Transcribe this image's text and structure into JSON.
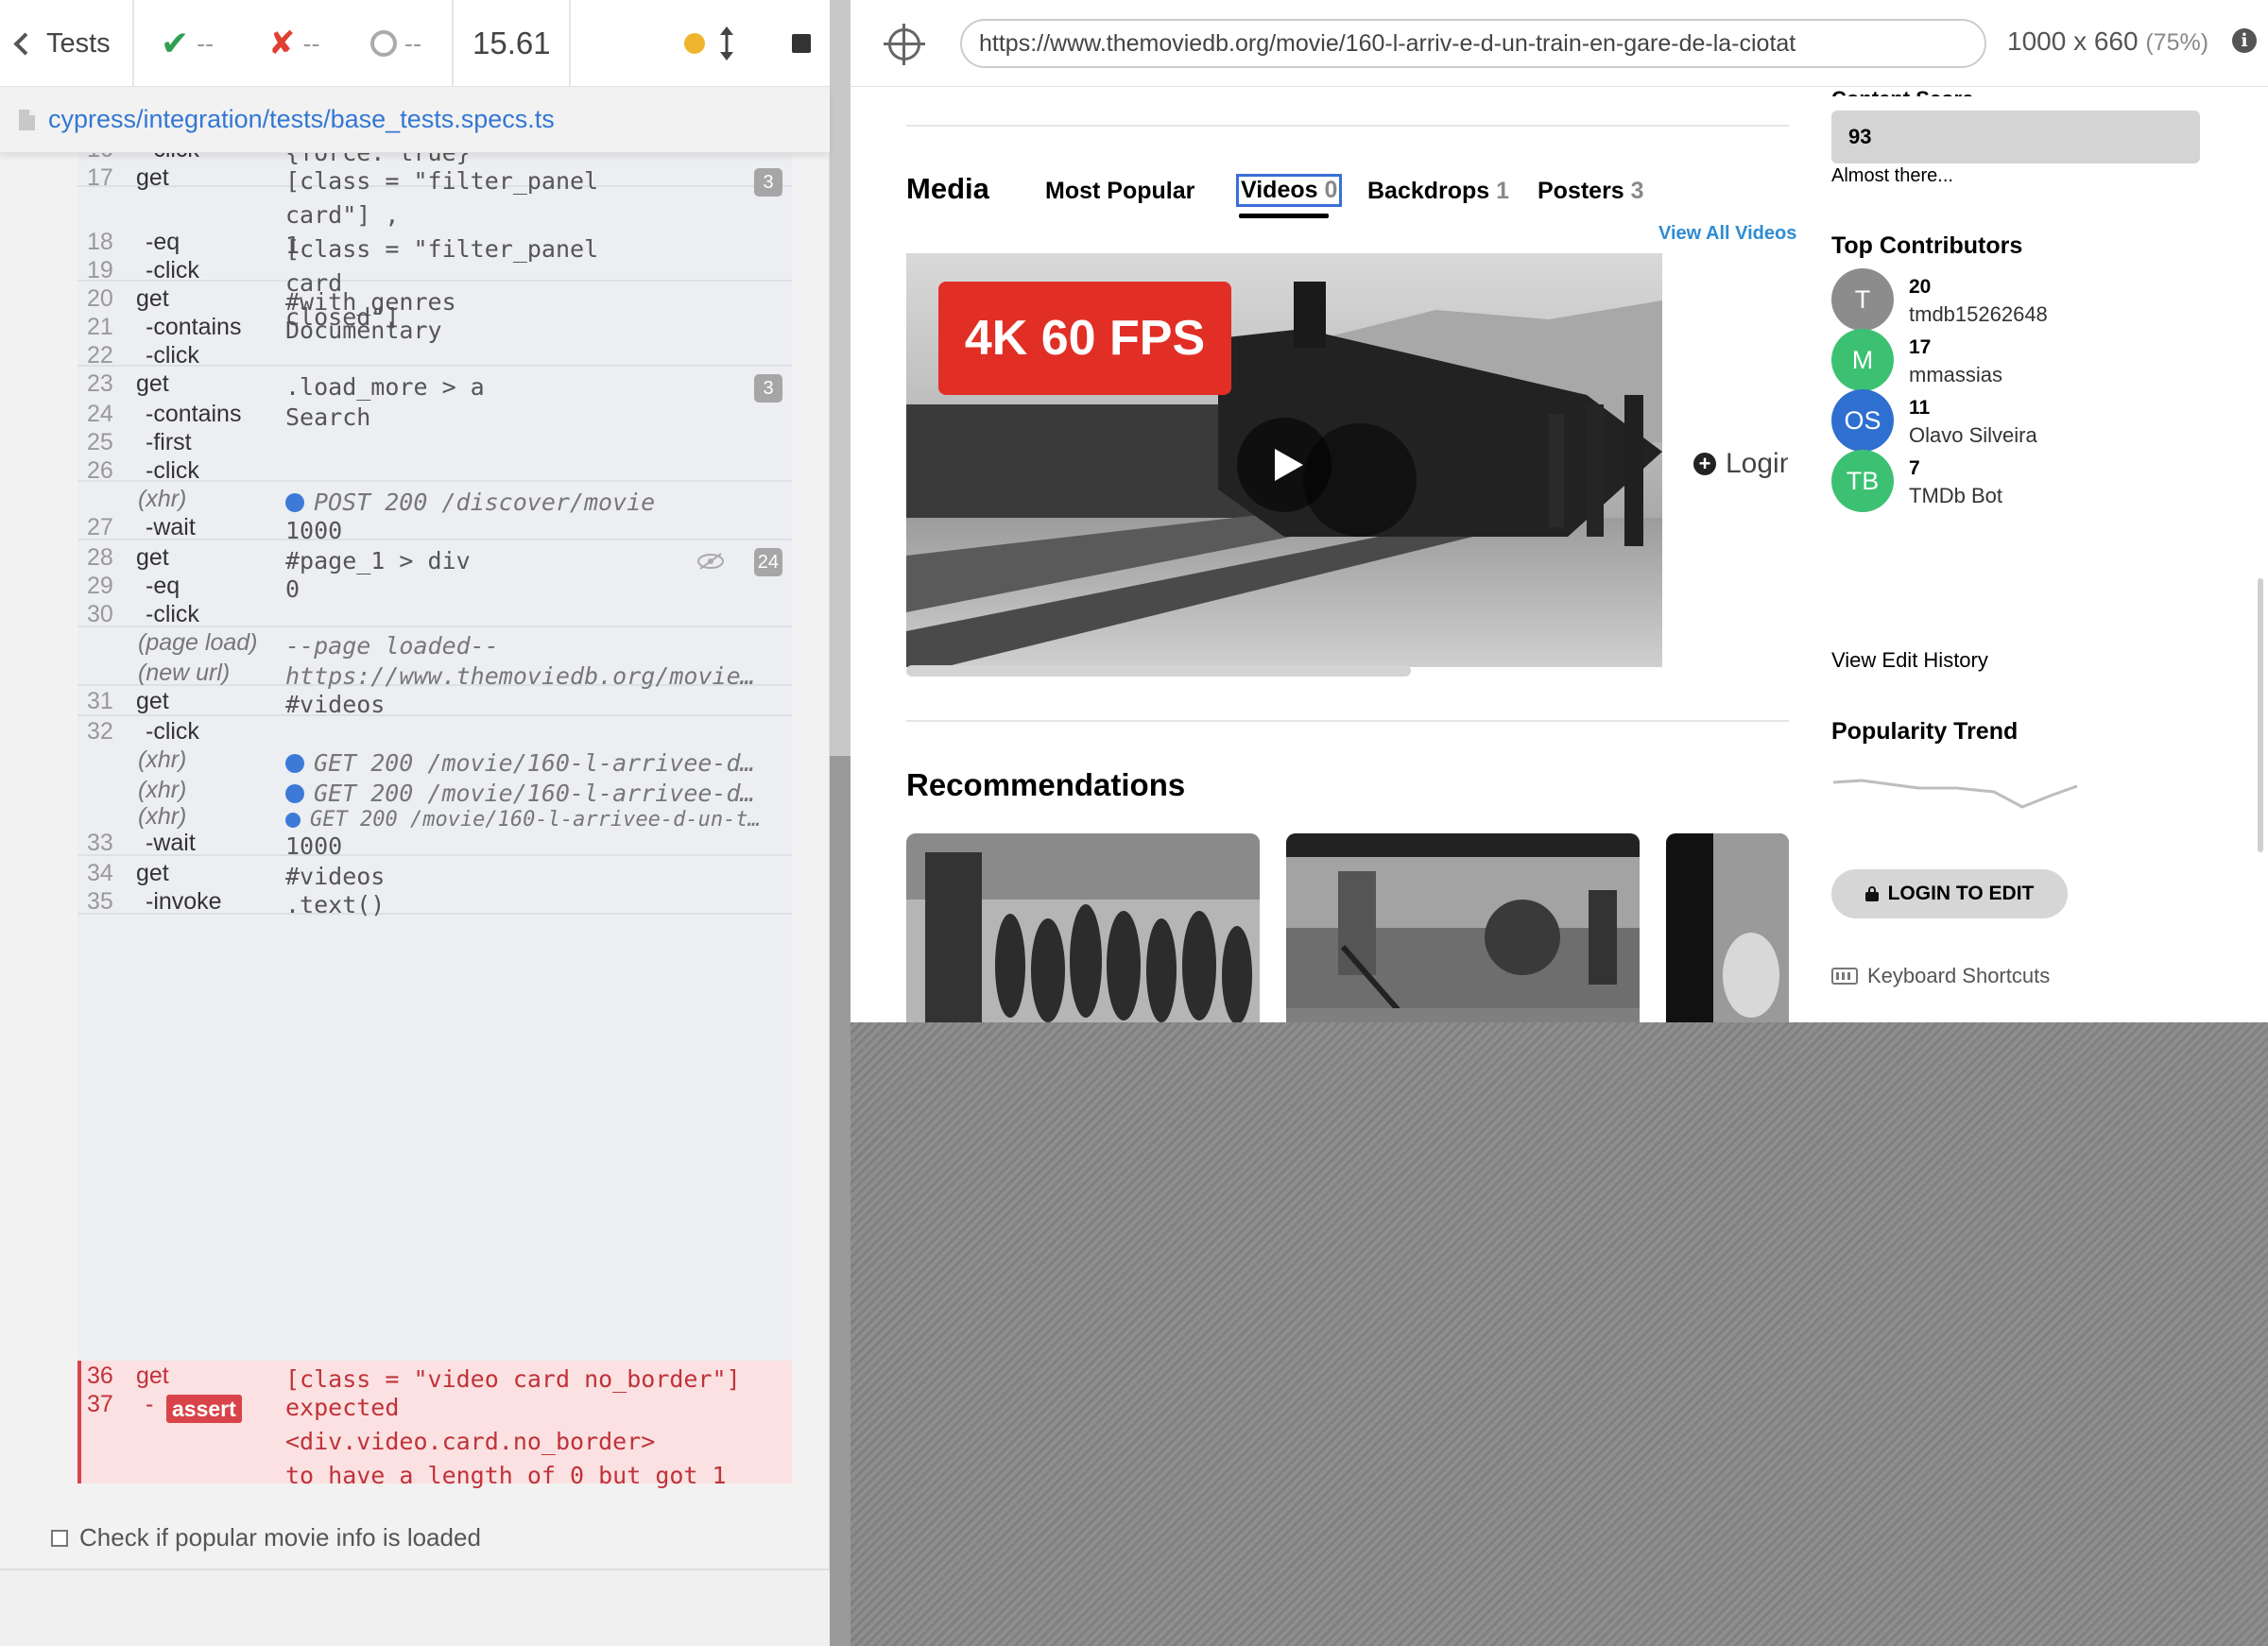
{
  "reporter": {
    "tests_label": "Tests",
    "passed": "--",
    "failed": "--",
    "pending": "--",
    "duration": "15.61",
    "spec_path": "cypress/integration/tests/base_tests.specs.ts",
    "test_title": "Check if popular movie info is loaded",
    "commands": [
      {
        "num": "16",
        "name": "-click",
        "msg": "{force: true}"
      },
      {
        "num": "17",
        "name": "get",
        "msg": "[class = \"filter_panel card\"] ,\n[class = \"filter_panel card\nclosed\"]",
        "badge": "3"
      },
      {
        "num": "18",
        "name": "-eq",
        "msg": "1"
      },
      {
        "num": "19",
        "name": "-click",
        "msg": ""
      },
      {
        "num": "20",
        "name": "get",
        "msg": "#with_genres"
      },
      {
        "num": "21",
        "name": "-contains",
        "msg": "Documentary"
      },
      {
        "num": "22",
        "name": "-click",
        "msg": ""
      },
      {
        "num": "23",
        "name": "get",
        "msg": ".load_more > a",
        "badge": "3"
      },
      {
        "num": "24",
        "name": "-contains",
        "msg": "Search"
      },
      {
        "num": "25",
        "name": "-first",
        "msg": ""
      },
      {
        "num": "26",
        "name": "-click",
        "msg": ""
      },
      {
        "num": "",
        "name": "(xhr)",
        "msg": "POST 200 /discover/movie"
      },
      {
        "num": "27",
        "name": "-wait",
        "msg": "1000"
      },
      {
        "num": "28",
        "name": "get",
        "msg": "#page_1 > div",
        "badge": "24"
      },
      {
        "num": "29",
        "name": "-eq",
        "msg": "0"
      },
      {
        "num": "30",
        "name": "-click",
        "msg": ""
      },
      {
        "num": "",
        "name": "(page load)",
        "msg": "--page loaded--"
      },
      {
        "num": "",
        "name": "(new url)",
        "msg": "https://www.themoviedb.org/movie/16…"
      },
      {
        "num": "31",
        "name": "get",
        "msg": "#videos"
      },
      {
        "num": "32",
        "name": "-click",
        "msg": ""
      },
      {
        "num": "",
        "name": "(xhr)",
        "msg": "GET 200 /movie/160-l-arrivee-d-un…"
      },
      {
        "num": "",
        "name": "(xhr)",
        "msg": "GET 200 /movie/160-l-arrivee-d-un…"
      },
      {
        "num": "",
        "name": "(xhr)",
        "msg": "GET 200 /movie/160-l-arrivee-d-un-train…"
      },
      {
        "num": "33",
        "name": "-wait",
        "msg": "1000"
      },
      {
        "num": "34",
        "name": "get",
        "msg": "#videos"
      },
      {
        "num": "35",
        "name": "-invoke",
        "msg": ".text()"
      },
      {
        "num": "36",
        "name": "get",
        "msg": "[class = \"video card no_border\"]"
      },
      {
        "num": "37",
        "name": "-",
        "tag": "assert",
        "msg": "expected <div.video.card.no_border>\nto have a length of 0 but got 1"
      }
    ]
  },
  "aut": {
    "url": "https://www.themoviedb.org/movie/160-l-arriv-e-d-un-train-en-gare-de-la-ciotat",
    "viewport": "1000 x 660",
    "scale": "(75%)",
    "info_glyph": "i",
    "media": {
      "title": "Media",
      "tabs": [
        {
          "label": "Most Popular",
          "count": ""
        },
        {
          "label": "Videos",
          "count": "0"
        },
        {
          "label": "Backdrops",
          "count": "1"
        },
        {
          "label": "Posters",
          "count": "3"
        }
      ],
      "view_all": "View All Videos",
      "video_badge": "4K 60 FPS",
      "login_peek": "Login"
    },
    "recommendations_title": "Recommendations",
    "sidebar": {
      "content_score_label": "Content Score",
      "score": "93",
      "score_note": "Almost there...",
      "contributors_title": "Top Contributors",
      "contributors": [
        {
          "initials": "T",
          "count": "20",
          "name": "tmdb15262648",
          "color": "#8c8c8c"
        },
        {
          "initials": "M",
          "count": "17",
          "name": "mmassias",
          "color": "#3cc173"
        },
        {
          "initials": "OS",
          "count": "11",
          "name": "Olavo Silveira",
          "color": "#2e6fd0"
        },
        {
          "initials": "TB",
          "count": "7",
          "name": "TMDb Bot",
          "color": "#3cc173"
        }
      ],
      "edit_history": "View Edit History",
      "trend_title": "Popularity Trend",
      "login_to_edit": "LOGIN TO EDIT",
      "shortcuts": "Keyboard Shortcuts"
    }
  }
}
